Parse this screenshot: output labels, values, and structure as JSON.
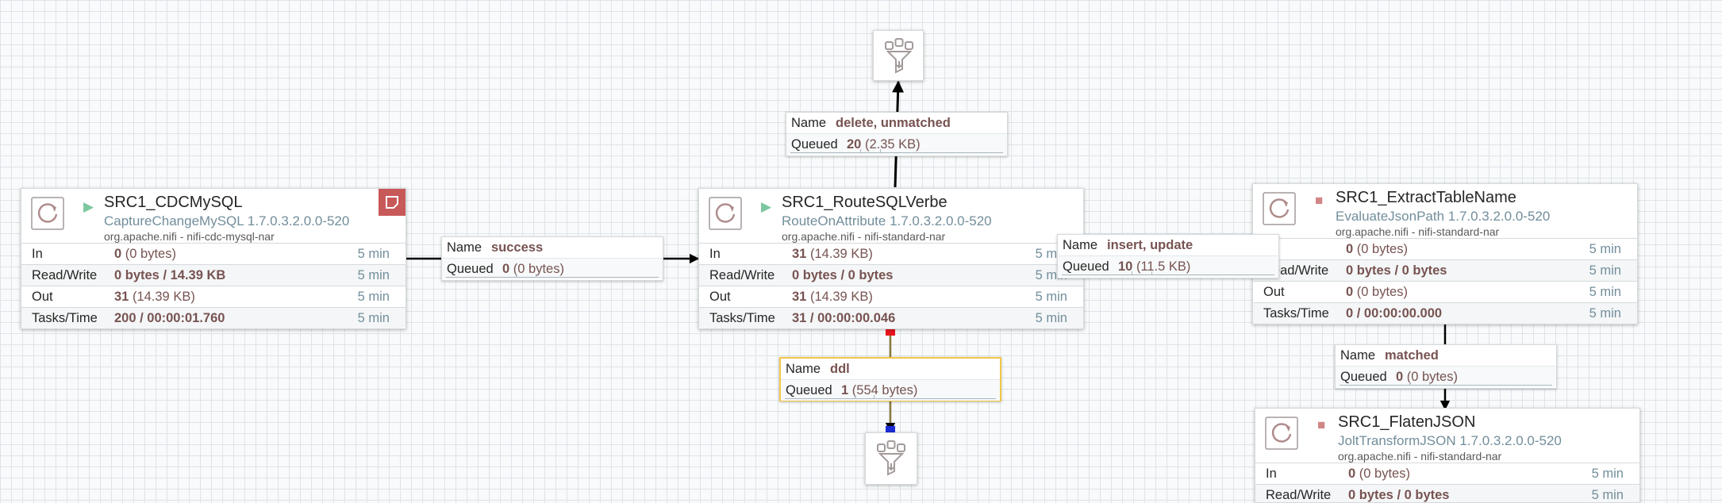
{
  "processors": [
    {
      "name": "SRC1_CDCMySQL",
      "type": "CaptureChangeMySQL 1.7.0.3.2.0.0-520",
      "bundle": "org.apache.nifi - nifi-cdc-mysql-nar",
      "state": "running",
      "has_bulletin": true,
      "stats": [
        {
          "label": "In",
          "value": "0",
          "detail": "(0 bytes)",
          "window": "5 min"
        },
        {
          "label": "Read/Write",
          "value": "0 bytes / 14.39 KB",
          "detail": "",
          "window": "5 min"
        },
        {
          "label": "Out",
          "value": "31",
          "detail": "(14.39 KB)",
          "window": "5 min"
        },
        {
          "label": "Tasks/Time",
          "value": "200 / 00:00:01.760",
          "detail": "",
          "window": "5 min"
        }
      ]
    },
    {
      "name": "SRC1_RouteSQLVerbe",
      "type": "RouteOnAttribute 1.7.0.3.2.0.0-520",
      "bundle": "org.apache.nifi - nifi-standard-nar",
      "state": "running",
      "has_bulletin": false,
      "stats": [
        {
          "label": "In",
          "value": "31",
          "detail": "(14.39 KB)",
          "window": "5 min"
        },
        {
          "label": "Read/Write",
          "value": "0 bytes / 0 bytes",
          "detail": "",
          "window": "5 min"
        },
        {
          "label": "Out",
          "value": "31",
          "detail": "(14.39 KB)",
          "window": "5 min"
        },
        {
          "label": "Tasks/Time",
          "value": "31 / 00:00:00.046",
          "detail": "",
          "window": "5 min"
        }
      ]
    },
    {
      "name": "SRC1_ExtractTableName",
      "type": "EvaluateJsonPath 1.7.0.3.2.0.0-520",
      "bundle": "org.apache.nifi - nifi-standard-nar",
      "state": "stopped",
      "has_bulletin": false,
      "stats": [
        {
          "label": "In",
          "value": "0",
          "detail": "(0 bytes)",
          "window": "5 min"
        },
        {
          "label": "Read/Write",
          "value": "0 bytes / 0 bytes",
          "detail": "",
          "window": "5 min"
        },
        {
          "label": "Out",
          "value": "0",
          "detail": "(0 bytes)",
          "window": "5 min"
        },
        {
          "label": "Tasks/Time",
          "value": "0 / 00:00:00.000",
          "detail": "",
          "window": "5 min"
        }
      ]
    },
    {
      "name": "SRC1_FlatenJSON",
      "type": "JoltTransformJSON 1.7.0.3.2.0.0-520",
      "bundle": "org.apache.nifi - nifi-standard-nar",
      "state": "stopped",
      "has_bulletin": false,
      "stats": [
        {
          "label": "In",
          "value": "0",
          "detail": "(0 bytes)",
          "window": "5 min"
        },
        {
          "label": "Read/Write",
          "value": "0 bytes / 0 bytes",
          "detail": "",
          "window": "5 min"
        }
      ]
    }
  ],
  "connections": [
    {
      "name_label": "Name",
      "name": "success",
      "queued_label": "Queued",
      "queued_count": "0",
      "queued_size": "(0 bytes)",
      "selected": false
    },
    {
      "name_label": "Name",
      "name": "delete, unmatched",
      "queued_label": "Queued",
      "queued_count": "20",
      "queued_size": "(2.35 KB)",
      "selected": false
    },
    {
      "name_label": "Name",
      "name": "insert, update",
      "queued_label": "Queued",
      "queued_count": "10",
      "queued_size": "(11.5 KB)",
      "selected": false
    },
    {
      "name_label": "Name",
      "name": "ddl",
      "queued_label": "Queued",
      "queued_count": "1",
      "queued_size": "(554 bytes)",
      "selected": true
    },
    {
      "name_label": "Name",
      "name": "matched",
      "queued_label": "Queued",
      "queued_count": "0",
      "queued_size": "(0 bytes)",
      "selected": false
    }
  ],
  "funnels": [
    {
      "icon": "funnel-icon"
    },
    {
      "icon": "funnel-icon"
    }
  ],
  "colors": {
    "running": "#7dc7a0",
    "stopped": "#d18686",
    "bulletin": "#c85959",
    "selection": "#f2c649",
    "bend_start": "#e8141c",
    "bend_end": "#1c2dd6",
    "processor_type": "#728e9b",
    "stat_value": "#775351"
  }
}
